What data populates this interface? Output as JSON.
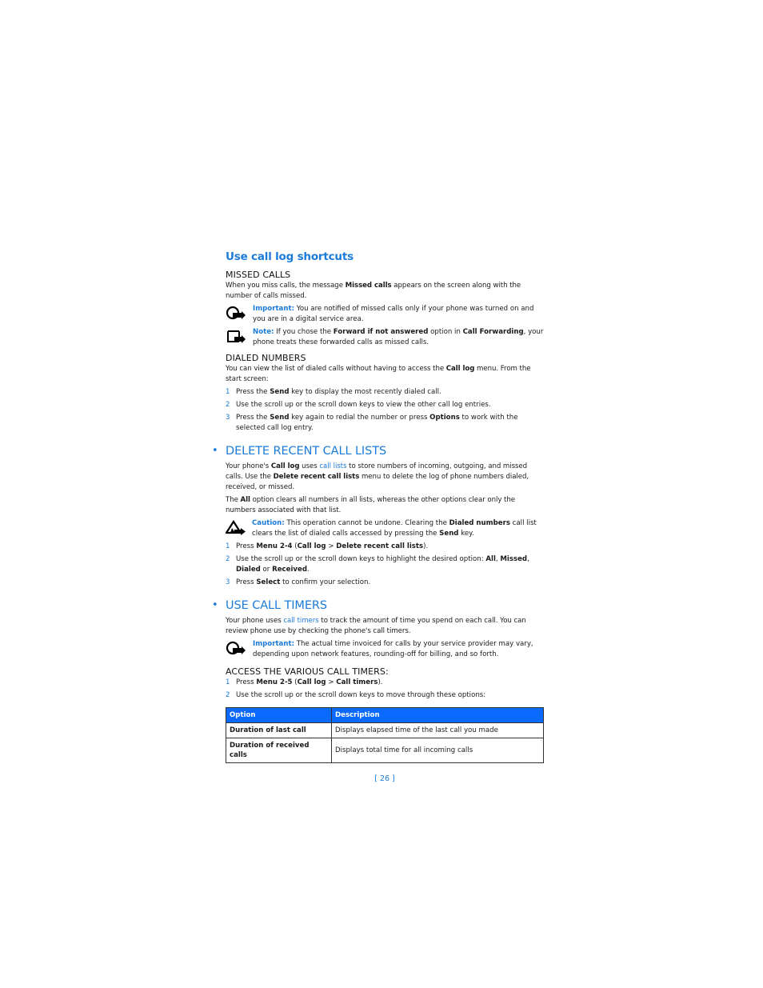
{
  "section1": {
    "title": "Use call log shortcuts",
    "missed": {
      "heading": "MISSED CALLS",
      "text_a": "When you miss calls, the message ",
      "text_b": "Missed calls",
      "text_c": " appears on the screen along with the number of calls missed.",
      "important_label": "Important:",
      "important_text": " You are notified of missed calls only if your phone was turned on and you are in a digital service area.",
      "note_label": "Note:",
      "note_a": " If you chose the ",
      "note_b": "Forward if not answered",
      "note_c": " option in ",
      "note_d": "Call Forwarding",
      "note_e": ", your phone treats these forwarded calls as missed calls."
    },
    "dialed": {
      "heading": "DIALED NUMBERS",
      "text_a": "You can view the list of dialed calls without having to access the ",
      "text_b": "Call log",
      "text_c": " menu. From the start screen:",
      "steps": [
        {
          "num": "1",
          "a": "Press the ",
          "b": "Send",
          "c": " key to display the most recently dialed call."
        },
        {
          "num": "2",
          "a": "Use the scroll up or the scroll down keys to view the other call log entries."
        },
        {
          "num": "3",
          "a": "Press the ",
          "b": "Send",
          "c": " key again to redial the number or press ",
          "d": "Options",
          "e": " to work with the selected call log entry."
        }
      ]
    }
  },
  "section2": {
    "bullet": "•",
    "title": "DELETE RECENT CALL LISTS",
    "p1_a": "Your phone's ",
    "p1_b": "Call log",
    "p1_c": " uses ",
    "p1_link": "call lists",
    "p1_d": " to store numbers of incoming, outgoing, and missed calls. Use the ",
    "p1_e": "Delete recent call lists",
    "p1_f": " menu to delete the log of phone numbers dialed, received, or missed.",
    "p2_a": "The ",
    "p2_b": "All",
    "p2_c": " option clears all numbers in all lists, whereas the other options clear only the numbers associated with that list.",
    "caution_label": "Caution:",
    "caution_a": " This operation cannot be undone. Clearing the ",
    "caution_b": "Dialed numbers",
    "caution_c": " call list clears the list of dialed calls accessed by pressing the ",
    "caution_d": "Send",
    "caution_e": " key.",
    "steps": [
      {
        "num": "1",
        "a": "Press ",
        "b": "Menu 2-4",
        "c": " (",
        "d": "Call log",
        "e": " > ",
        "f": "Delete recent call lists",
        "g": ")."
      },
      {
        "num": "2",
        "a": "Use the scroll up or the scroll down keys to highlight the desired option: ",
        "b": "All",
        "c": ", ",
        "d": "Missed",
        "e": ", ",
        "f": "Dialed",
        "g": " or ",
        "h": "Received",
        "i": "."
      },
      {
        "num": "3",
        "a": "Press ",
        "b": "Select",
        "c": " to confirm your selection."
      }
    ]
  },
  "section3": {
    "bullet": "•",
    "title": "USE CALL TIMERS",
    "p1_a": "Your phone uses ",
    "p1_link": "call timers",
    "p1_b": " to track the amount of time you spend on each call. You can review phone use by checking the phone's call timers.",
    "important_label": "Important:",
    "important_text": " The actual time invoiced for calls by your service provider may vary, depending upon network features, rounding-off for billing, and so forth.",
    "access_heading": "ACCESS THE VARIOUS CALL TIMERS:",
    "steps": [
      {
        "num": "1",
        "a": "Press ",
        "b": "Menu 2-5",
        "c": " (",
        "d": "Call log",
        "e": " > ",
        "f": "Call timers",
        "g": ")."
      },
      {
        "num": "2",
        "a": "Use the scroll up or the scroll down keys to move through these options:"
      }
    ],
    "table": {
      "headers": [
        "Option",
        "Description"
      ],
      "rows": [
        [
          "Duration of last call",
          "Displays elapsed time of the last call you made"
        ],
        [
          "Duration of received calls",
          "Displays total time for all incoming calls"
        ]
      ]
    }
  },
  "footer": {
    "page_number": "[ 26 ]"
  },
  "colors": {
    "accent": "#1c7bd9",
    "table_header": "#0a6aff"
  },
  "icons": {
    "important": "important-icon",
    "note": "note-icon",
    "caution": "caution-icon"
  }
}
